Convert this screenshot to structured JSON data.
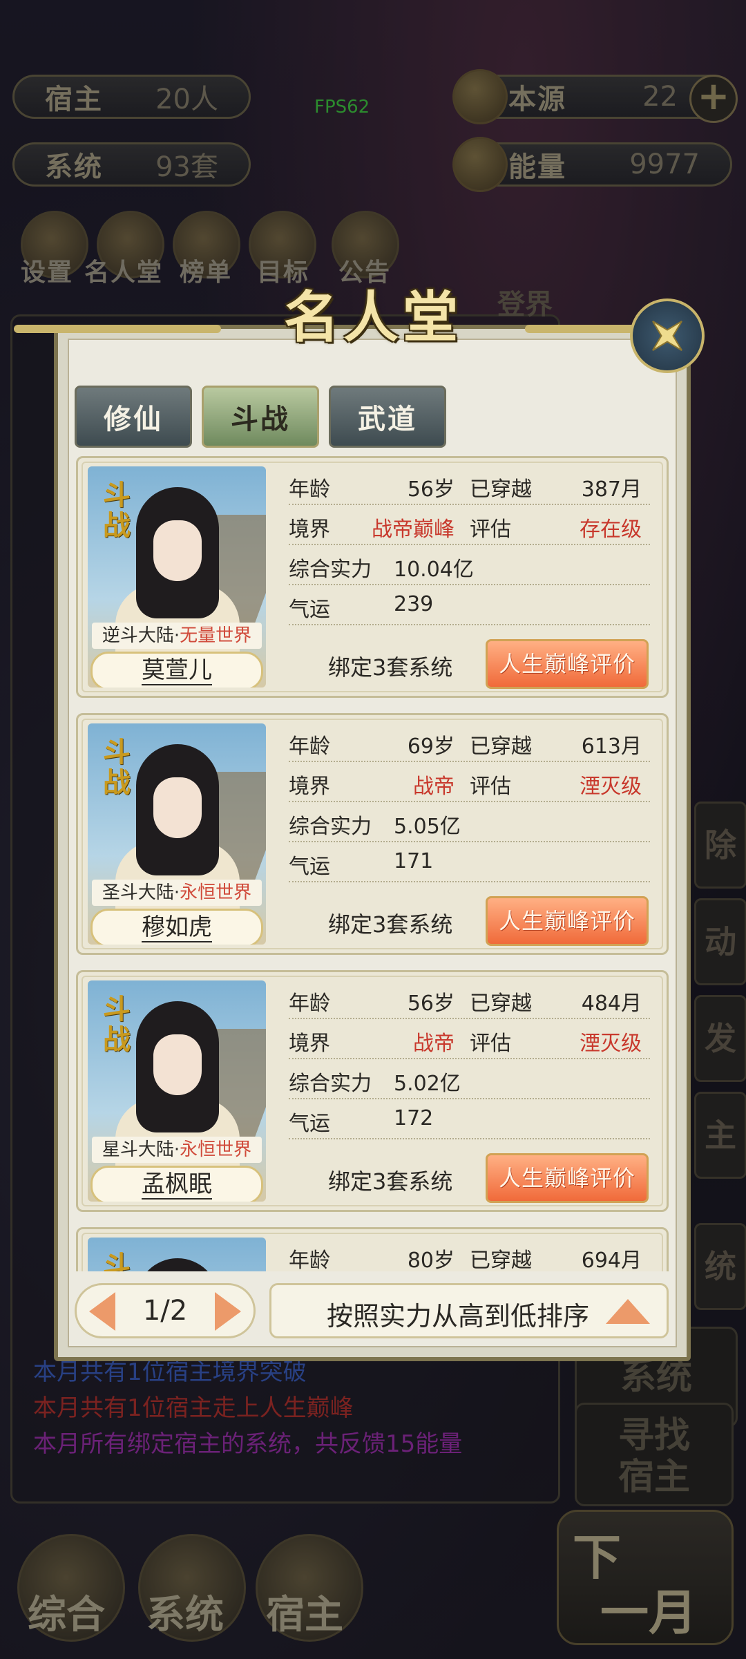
{
  "hud": {
    "host_label": "宿主",
    "host_value": "20人",
    "system_label": "系统",
    "system_value": "93套",
    "origin_label": "本源",
    "origin_value": "22",
    "energy_label": "能量",
    "energy_value": "9977",
    "fps": "FPS62"
  },
  "top_menu": [
    "设置",
    "名人堂",
    "榜单",
    "目标",
    "公告"
  ],
  "background_labels": {
    "realm_tag": "登界",
    "side_buttons": [
      "除",
      "动",
      "发",
      "主",
      "统"
    ],
    "right_box_system": "系统",
    "find_host_line1": "寻找",
    "find_host_line2": "宿主"
  },
  "log": {
    "line1": "本月共有1位宿主境界突破",
    "line2": "本月共有1位宿主走上人生巅峰",
    "line3": "本月所有绑定宿主的系统，共反馈15能量",
    "line1_color": "#3a5fc4",
    "line2_color": "#b8302a",
    "line3_color": "#a02fb0"
  },
  "bottom_nav": {
    "overall": "综合",
    "system": "系统",
    "host": "宿主",
    "next_line1": "下",
    "next_line2": "一月"
  },
  "modal": {
    "title": "名人堂",
    "tabs": [
      "修仙",
      "斗战",
      "武道"
    ],
    "active_tab": 1,
    "labels": {
      "age": "年龄",
      "traveled": "已穿越",
      "realm": "境界",
      "rating": "评估",
      "power": "综合实力",
      "luck": "气运"
    },
    "peak_button": "人生巅峰评价",
    "cards": [
      {
        "tag": "斗战",
        "world_prefix": "逆斗大陆·",
        "world_suffix": "无量世界",
        "name": "莫萱儿",
        "age": "56岁",
        "traveled": "387月",
        "realm": "战帝巅峰",
        "rating": "存在级",
        "power": "10.04亿",
        "luck": "239",
        "bind": "绑定3套系统"
      },
      {
        "tag": "斗战",
        "world_prefix": "圣斗大陆·",
        "world_suffix": "永恒世界",
        "name": "穆如虎",
        "age": "69岁",
        "traveled": "613月",
        "realm": "战帝",
        "rating": "湮灭级",
        "power": "5.05亿",
        "luck": "171",
        "bind": "绑定3套系统"
      },
      {
        "tag": "斗战",
        "world_prefix": "星斗大陆·",
        "world_suffix": "永恒世界",
        "name": "孟枫眠",
        "age": "56岁",
        "traveled": "484月",
        "realm": "战帝",
        "rating": "湮灭级",
        "power": "5.02亿",
        "luck": "172",
        "bind": "绑定3套系统"
      },
      {
        "tag": "斗",
        "age": "80岁",
        "traveled": "694月"
      }
    ],
    "pager": "1/2",
    "sort_label": "按照实力从高到低排序"
  },
  "colors": {
    "accent_red": "#c8382c",
    "button_orange": "#f06a3a",
    "panel_bg": "#eceae0",
    "gold": "#c9b56c"
  }
}
